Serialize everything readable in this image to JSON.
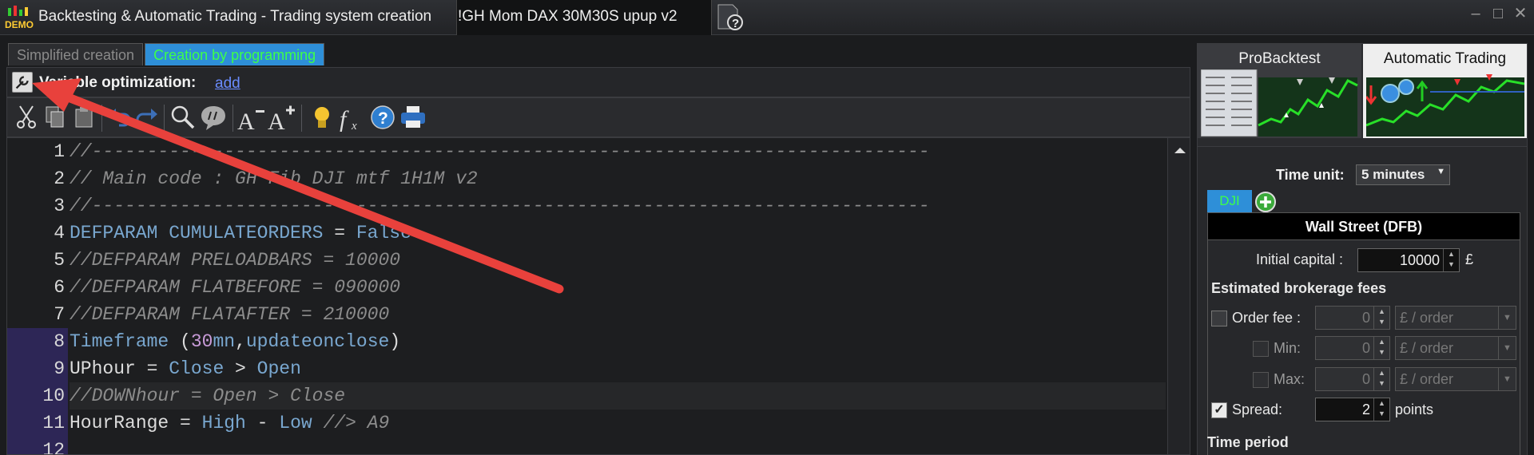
{
  "window": {
    "title": "Backtesting & Automatic Trading - Trading system creation",
    "tab": "!GH Mom DAX 30M30S upup v2",
    "logo_text": "DEMO"
  },
  "mode_tabs": [
    "Simplified creation",
    "Creation by programming"
  ],
  "var_opt": {
    "label": "Variable optimization:",
    "link": "add"
  },
  "toolbar_icons": [
    "cut-icon",
    "copy-icon",
    "paste-icon",
    "undo-icon",
    "redo-icon",
    "search-icon",
    "comment-icon",
    "font-decrease-icon",
    "font-increase-icon",
    "lightbulb-icon",
    "function-icon",
    "help-icon",
    "print-icon"
  ],
  "code": {
    "lines": [
      {
        "n": "1",
        "mark": false,
        "cur": false,
        "seg": [
          {
            "t": "//----------------------------------------------------------------------------",
            "c": "com"
          }
        ]
      },
      {
        "n": "2",
        "mark": false,
        "cur": false,
        "seg": [
          {
            "t": "// Main code : GH Fib DJI mtf 1H1M v2",
            "c": "com"
          }
        ]
      },
      {
        "n": "3",
        "mark": false,
        "cur": false,
        "seg": [
          {
            "t": "//----------------------------------------------------------------------------",
            "c": "com"
          }
        ]
      },
      {
        "n": "4",
        "mark": false,
        "cur": false,
        "seg": [
          {
            "t": "DEFPARAM CUMULATEORDERS",
            "c": "kw"
          },
          {
            "t": " = ",
            "c": "norm"
          },
          {
            "t": "False",
            "c": "kw"
          }
        ]
      },
      {
        "n": "5",
        "mark": false,
        "cur": false,
        "seg": [
          {
            "t": "//DEFPARAM PRELOADBARS = 10000",
            "c": "com"
          }
        ]
      },
      {
        "n": "6",
        "mark": false,
        "cur": false,
        "seg": [
          {
            "t": "//DEFPARAM FLATBEFORE = 090000",
            "c": "com"
          }
        ]
      },
      {
        "n": "7",
        "mark": false,
        "cur": false,
        "seg": [
          {
            "t": "//DEFPARAM FLATAFTER = 210000",
            "c": "com"
          }
        ]
      },
      {
        "n": "8",
        "mark": true,
        "cur": false,
        "seg": [
          {
            "t": "Timeframe",
            "c": "kw"
          },
          {
            "t": " (",
            "c": "norm"
          },
          {
            "t": "30",
            "c": "num"
          },
          {
            "t": "mn",
            "c": "kw"
          },
          {
            "t": ",",
            "c": "norm"
          },
          {
            "t": "updateonclose",
            "c": "kw"
          },
          {
            "t": ")",
            "c": "norm"
          }
        ]
      },
      {
        "n": "9",
        "mark": true,
        "cur": false,
        "seg": [
          {
            "t": "UPhour = ",
            "c": "norm"
          },
          {
            "t": "Close",
            "c": "kw"
          },
          {
            "t": " > ",
            "c": "norm"
          },
          {
            "t": "Open",
            "c": "kw"
          }
        ]
      },
      {
        "n": "10",
        "mark": true,
        "cur": true,
        "seg": [
          {
            "t": "//DOWNhour = Open > Close",
            "c": "com"
          }
        ]
      },
      {
        "n": "11",
        "mark": true,
        "cur": false,
        "seg": [
          {
            "t": "HourRange = ",
            "c": "norm"
          },
          {
            "t": "High",
            "c": "kw"
          },
          {
            "t": " - ",
            "c": "norm"
          },
          {
            "t": "Low",
            "c": "kw"
          },
          {
            "t": " //> A9",
            "c": "com"
          }
        ]
      },
      {
        "n": "12",
        "mark": true,
        "cur": false,
        "seg": []
      }
    ]
  },
  "right_panel": {
    "modes": [
      "ProBacktest",
      "Automatic Trading"
    ],
    "time_unit_label": "Time unit:",
    "time_unit_value": "5 minutes",
    "instrument_tab": "DJI",
    "instrument_name": "Wall Street (DFB)",
    "initial_capital_label": "Initial capital :",
    "initial_capital_value": "10000",
    "currency": "£",
    "fees_title": "Estimated brokerage fees",
    "order_fee_label": "Order fee :",
    "order_fee_value": "0",
    "min_label": "Min:",
    "min_value": "0",
    "max_label": "Max:",
    "max_value": "0",
    "per_order": "£ / order",
    "spread_label": "Spread:",
    "spread_value": "2",
    "spread_checked": true,
    "points": "points",
    "time_period": "Time period"
  },
  "colors": {
    "accent": "#2e8fd8",
    "tab_text": "#3dff4a",
    "annotation_arrow": "#e8413c"
  }
}
